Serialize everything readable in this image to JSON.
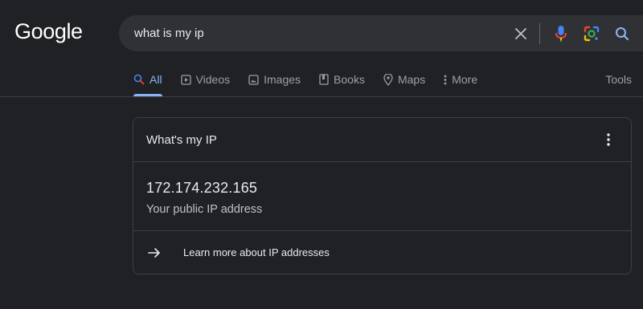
{
  "header": {
    "logo_text": "Google",
    "search": {
      "query": "what is my ip"
    },
    "icons": [
      "clear-icon",
      "mic-icon",
      "lens-icon",
      "search-icon"
    ],
    "colors": {
      "accent": "#8ab4f8",
      "background": "#202124",
      "search_bg": "#303134"
    }
  },
  "tabs": {
    "items": [
      {
        "label": "All",
        "icon": "search-icon",
        "active": true
      },
      {
        "label": "Videos",
        "icon": "video-icon"
      },
      {
        "label": "Images",
        "icon": "image-icon"
      },
      {
        "label": "Books",
        "icon": "book-icon"
      },
      {
        "label": "Maps",
        "icon": "map-pin-icon"
      },
      {
        "label": "More",
        "icon": "more-vert-icon"
      }
    ],
    "tools_label": "Tools"
  },
  "card": {
    "title": "What's my IP",
    "ip_address": "172.174.232.165",
    "ip_caption": "Your public IP address",
    "link_label": "Learn more about IP addresses"
  }
}
